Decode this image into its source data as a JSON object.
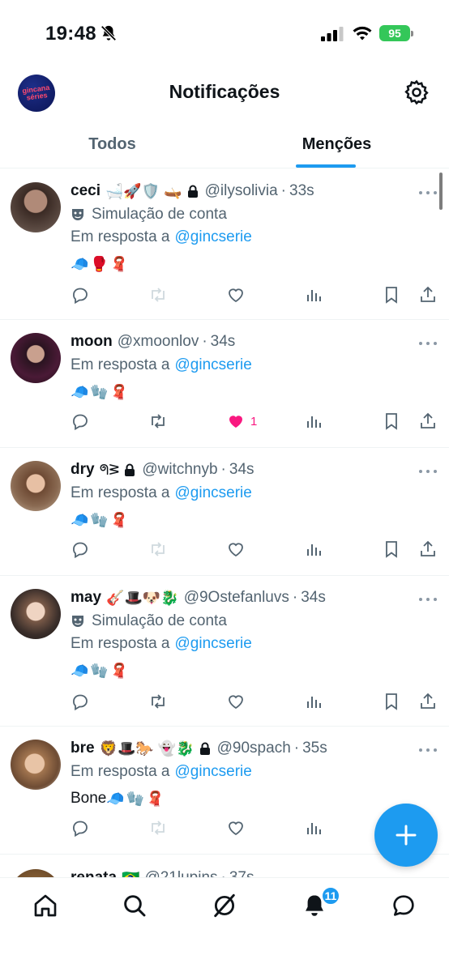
{
  "status_bar": {
    "time": "19:48",
    "battery": "95"
  },
  "header": {
    "logo_text": "gincana séries",
    "title": "Notificações"
  },
  "tabs": [
    {
      "label": "Todos"
    },
    {
      "label": "Menções"
    }
  ],
  "posts": [
    {
      "name": "ceci",
      "emojis": "🛁🚀🛡️ 🛶",
      "locked": true,
      "handle": "@ilysolivia",
      "sep": "·",
      "time": "33s",
      "sim_label": "Simulação de conta",
      "reply_prefix": "Em resposta a",
      "reply_handle": "@gincserie",
      "content_text": "",
      "content_emojis": "🧢🥊🧣",
      "likes": ""
    },
    {
      "name": "moon",
      "emojis": "",
      "locked": false,
      "handle": "@xmoonlov",
      "sep": "·",
      "time": "34s",
      "sim_label": "",
      "reply_prefix": "Em resposta a",
      "reply_handle": "@gincserie",
      "content_text": "",
      "content_emojis": "🧢🧤🧣",
      "likes": "1"
    },
    {
      "name": "dry",
      "emojis": "ᖗᕒ",
      "locked": true,
      "handle": "@witchnyb",
      "sep": "·",
      "time": "34s",
      "sim_label": "",
      "reply_prefix": "Em resposta a",
      "reply_handle": "@gincserie",
      "content_text": "",
      "content_emojis": "🧢🧤🧣",
      "likes": ""
    },
    {
      "name": "may",
      "emojis": "🎸🎩🐶🐉",
      "locked": false,
      "handle": "@9Ostefanluvs",
      "sep": "·",
      "time": "34s",
      "sim_label": "Simulação de conta",
      "reply_prefix": "Em resposta a",
      "reply_handle": "@gincserie",
      "content_text": "",
      "content_emojis": "🧢🧤🧣",
      "likes": ""
    },
    {
      "name": "bre",
      "emojis": "🦁🎩🐎 👻🐉",
      "locked": true,
      "handle": "@90spach",
      "sep": "·",
      "time": "35s",
      "sim_label": "",
      "reply_prefix": "Em resposta a",
      "reply_handle": "@gincserie",
      "content_text": "Bone",
      "content_emojis": "🧢🧤🧣",
      "likes": ""
    },
    {
      "name": "renata",
      "emojis": "🇧🇷",
      "locked": false,
      "handle": "@21lupins",
      "sep": "·",
      "time": "37s",
      "sim_label": "",
      "reply_prefix": "",
      "reply_handle": "",
      "content_text": "",
      "content_emojis": "",
      "likes": ""
    }
  ],
  "bottom_nav": {
    "notifications_badge": "11"
  },
  "colors": {
    "accent": "#1d9bf0",
    "like": "#f91880",
    "muted": "#536471"
  }
}
